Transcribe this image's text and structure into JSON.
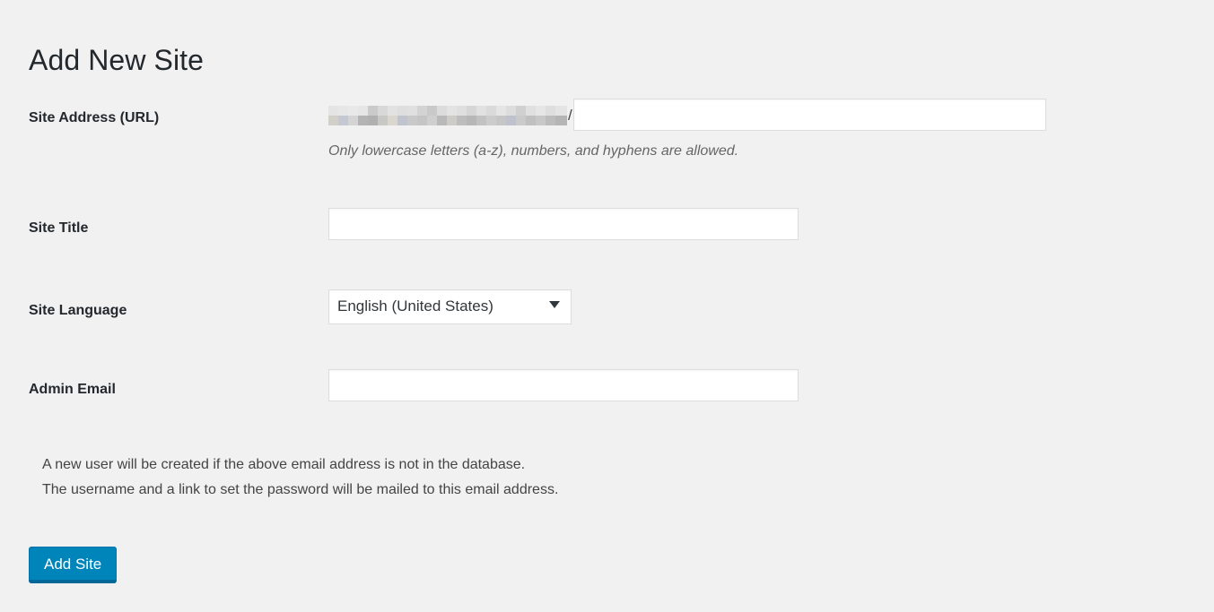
{
  "page": {
    "title": "Add New Site",
    "background_color": "#f1f1f1"
  },
  "form": {
    "fields": [
      {
        "id": "site-address",
        "label": "Site Address (URL)",
        "prefix_redacted": true,
        "prefix_separator": "/",
        "value": "",
        "placeholder": "",
        "description": "Only lowercase letters (a-z), numbers, and hyphens are allowed."
      },
      {
        "id": "site-title",
        "label": "Site Title",
        "value": "",
        "placeholder": ""
      },
      {
        "id": "site-language",
        "label": "Site Language",
        "selected": "English (United States)",
        "options": [
          "English (United States)"
        ],
        "arrow_icon": "chevron-down-icon"
      },
      {
        "id": "admin-email",
        "label": "Admin Email",
        "value": "",
        "placeholder": ""
      }
    ],
    "notes": [
      "A new user will be created if the above email address is not in the database.",
      "The username and a link to set the password will be mailed to this email address."
    ],
    "submit": {
      "label": "Add Site",
      "background_color": "#0085ba",
      "text_color": "#ffffff",
      "border_color": "#006799"
    }
  }
}
